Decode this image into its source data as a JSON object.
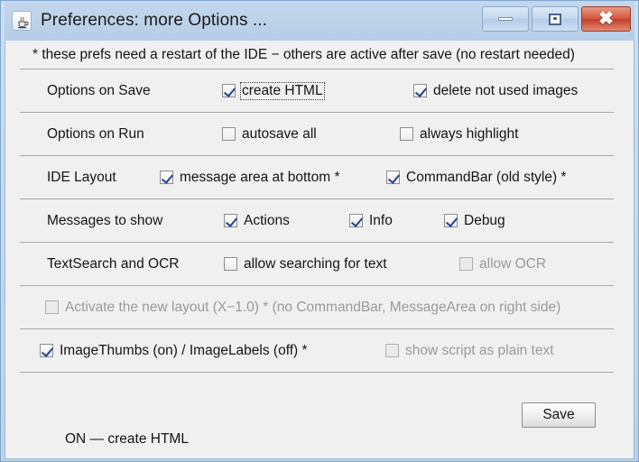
{
  "window": {
    "title": "Preferences: more Options ...",
    "icon": "java-coffee-cup-icon",
    "controls": {
      "minimize": "minimize-icon",
      "maximize": "maximize-icon",
      "close": "✖"
    }
  },
  "note": "* these prefs need a restart of the IDE − others are active after save (no restart needed)",
  "rows": [
    {
      "label": "Options on Save",
      "options": [
        {
          "text": "create HTML",
          "checked": true,
          "disabled": false,
          "focused": true
        },
        {
          "text": "delete not used images",
          "checked": true,
          "disabled": false,
          "focused": false
        }
      ]
    },
    {
      "label": "Options on Run",
      "options": [
        {
          "text": "autosave all",
          "checked": false,
          "disabled": false,
          "focused": false
        },
        {
          "text": "always highlight",
          "checked": false,
          "disabled": false,
          "focused": false
        }
      ]
    },
    {
      "label": "IDE Layout",
      "options": [
        {
          "text": "message area at bottom *",
          "checked": true,
          "disabled": false,
          "focused": false
        },
        {
          "text": "CommandBar (old style) *",
          "checked": true,
          "disabled": false,
          "focused": false
        }
      ]
    },
    {
      "label": "Messages to show",
      "options": [
        {
          "text": "Actions",
          "checked": true,
          "disabled": false,
          "focused": false
        },
        {
          "text": "Info",
          "checked": true,
          "disabled": false,
          "focused": false
        },
        {
          "text": "Debug",
          "checked": true,
          "disabled": false,
          "focused": false
        }
      ]
    },
    {
      "label": "TextSearch and OCR",
      "options": [
        {
          "text": "allow searching for text",
          "checked": false,
          "disabled": false,
          "focused": false
        },
        {
          "text": "allow OCR",
          "checked": false,
          "disabled": true,
          "focused": false
        }
      ]
    },
    {
      "label": "",
      "options": [
        {
          "text": "Activate the new layout (X−1.0) *  (no CommandBar, MessageArea on right side)",
          "checked": false,
          "disabled": true,
          "focused": false
        }
      ]
    },
    {
      "label": "",
      "options": [
        {
          "text": "ImageThumbs (on) / ImageLabels (off) *",
          "checked": true,
          "disabled": false,
          "focused": false
        },
        {
          "text": "show script as plain text",
          "checked": false,
          "disabled": true,
          "focused": false
        }
      ]
    }
  ],
  "footer": {
    "save_label": "Save",
    "status": "ON — create HTML"
  }
}
